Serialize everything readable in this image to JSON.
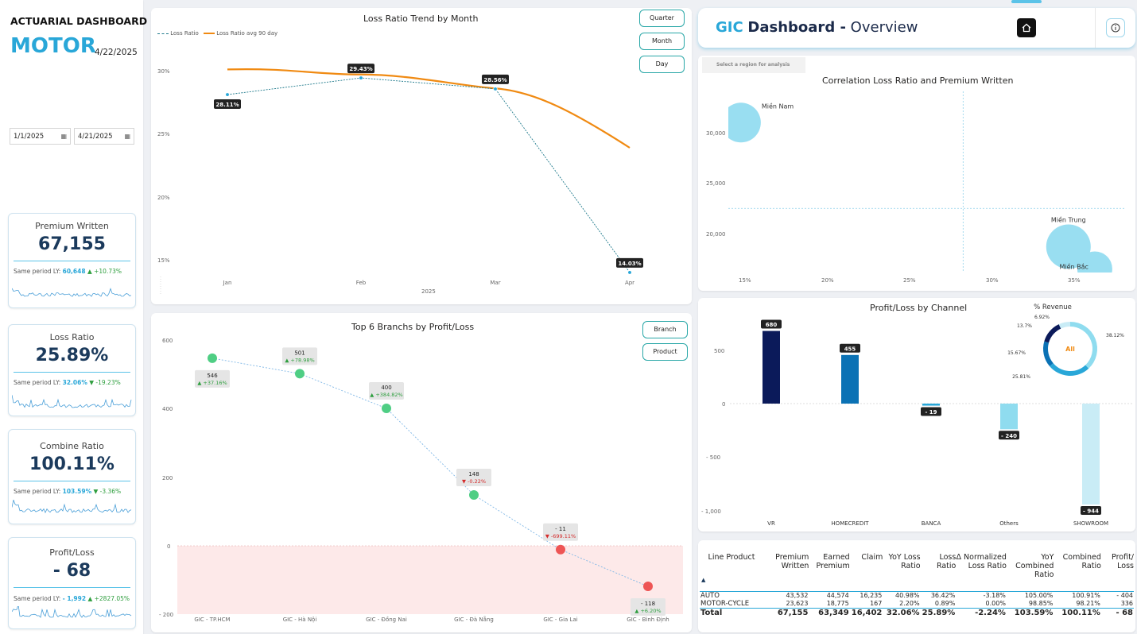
{
  "header": {
    "title": "ACTUARIAL DASHBOARD",
    "segment": "MOTOR",
    "date": "4/22/2025"
  },
  "date_range": {
    "start": "1/1/2025",
    "end": "4/21/2025"
  },
  "kpis": [
    {
      "title": "Premium Written",
      "value": "67,155",
      "ly_label": "Same period LY:",
      "ly_value": "60,648",
      "change": "▲ +10.73%",
      "dir": "up"
    },
    {
      "title": "Loss Ratio",
      "value": "25.89%",
      "ly_label": "Same period LY:",
      "ly_value": "32.06%",
      "change": "▼ -19.23%",
      "dir": "down"
    },
    {
      "title": "Combine Ratio",
      "value": "100.11%",
      "ly_label": "Same period LY:",
      "ly_value": "103.59%",
      "change": "▼ -3.36%",
      "dir": "down"
    },
    {
      "title": "Profit/Loss",
      "value": "- 68",
      "ly_label": "Same period LY:",
      "ly_value": "- 1,992",
      "change": "▲ +2827.05%",
      "dir": "up"
    }
  ],
  "loss_trend": {
    "title": "Loss Ratio Trend by Month",
    "legend": [
      "Loss Ratio",
      "Loss Ratio avg 90 day"
    ],
    "buttons": [
      "Quarter",
      "Month",
      "Day"
    ],
    "xlabel": "2025",
    "yticks": [
      "30%",
      "25%",
      "20%",
      "15%"
    ]
  },
  "branch_chart": {
    "title": "Top 6 Branchs by Profit/Loss",
    "buttons": [
      "Branch",
      "Product"
    ],
    "yticks": [
      "600",
      "400",
      "200",
      "0",
      "- 200"
    ]
  },
  "gic": {
    "brand": "GIC",
    "title": "Dashboard -",
    "subtitle": "Overview",
    "home_icon": "home-icon",
    "info_icon": "info-icon",
    "region_select": "Select a region for analysis"
  },
  "scatter": {
    "title": "Correlation Loss Ratio and Premium Written",
    "xticks": [
      "15%",
      "20%",
      "25%",
      "30%",
      "35%"
    ],
    "yticks": [
      "30,000",
      "25,000",
      "20,000"
    ]
  },
  "channel": {
    "title": "Profit/Loss by Channel",
    "yticks": [
      "500",
      "0",
      "- 500",
      "- 1,000"
    ],
    "donut_title": "% Revenue",
    "donut_center": "All"
  },
  "table": {
    "headers": [
      "Line Product",
      "Premium Written",
      "Earned Premium",
      "Claim",
      "YoY Loss Ratio",
      "Loss Ratio",
      "Δ Normalized Loss Ratio",
      "YoY Combined Ratio",
      "Combined Ratio",
      "Profit/ Loss"
    ],
    "rows": [
      [
        "AUTO",
        "43,532",
        "44,574",
        "16,235",
        "40.98%",
        "36.42%",
        "-3.18%",
        "105.00%",
        "100.91%",
        "- 404"
      ],
      [
        "MOTOR-CYCLE",
        "23,623",
        "18,775",
        "167",
        "2.20%",
        "0.89%",
        "0.00%",
        "98.85%",
        "98.21%",
        "336"
      ]
    ],
    "total": [
      "Total",
      "67,155",
      "63,349",
      "16,402",
      "32.06%",
      "25.89%",
      "-2.24%",
      "103.59%",
      "100.11%",
      "- 68"
    ]
  },
  "chart_data": [
    {
      "type": "line",
      "title": "Loss Ratio Trend by Month",
      "x": [
        "Jan",
        "Feb",
        "Mar",
        "Apr"
      ],
      "xlabel": "2025",
      "ylim": [
        14,
        31
      ],
      "series": [
        {
          "name": "Loss Ratio",
          "values": [
            28.11,
            29.43,
            28.56,
            14.03
          ],
          "labels": [
            "28.11%",
            "29.43%",
            "28.56%",
            "14.03%"
          ],
          "color": "#1f7a8c"
        },
        {
          "name": "Loss Ratio avg 90 day",
          "values": [
            30.1,
            29.7,
            28.6,
            23.9
          ],
          "color": "#f08a12"
        }
      ]
    },
    {
      "type": "line",
      "title": "Top 6 Branchs by Profit/Loss",
      "categories": [
        "GIC - TP.HCM",
        "GIC - Hà Nội",
        "GIC - Đồng Nai",
        "GIC - Đà Nẵng",
        "GIC - Gia Lai",
        "GIC - Bình Định"
      ],
      "values": [
        546,
        501,
        400,
        148,
        -11,
        -118
      ],
      "value_labels": [
        "546",
        "501",
        "400",
        "148",
        "- 11",
        "- 118"
      ],
      "changes": [
        "▲ +37.16%",
        "▲ +78.98%",
        "▲ +384.82%",
        "▼ -0.22%",
        "▼ -699.11%",
        "▲ +6.20%"
      ],
      "ylim": [
        -200,
        600
      ]
    },
    {
      "type": "scatter",
      "title": "Correlation Loss Ratio and Premium Written",
      "xlim": [
        13,
        36.5
      ],
      "ylim": [
        15600,
        32000
      ],
      "points": [
        {
          "name": "Miền Nam",
          "x": 14.8,
          "y": 31000,
          "r": 25
        },
        {
          "name": "Miền Trung",
          "x": 34.7,
          "y": 18700,
          "r": 28
        },
        {
          "name": "Miền Bắc",
          "x": 36.3,
          "y": 16500,
          "r": 22
        }
      ],
      "ref_x": 28.3,
      "ref_y": 22500
    },
    {
      "type": "bar",
      "title": "Profit/Loss by Channel",
      "categories": [
        "VR",
        "HOMECREDIT",
        "BANCA",
        "Others",
        "SHOWROOM"
      ],
      "values": [
        680,
        455,
        -19,
        -240,
        -944
      ],
      "labels": [
        "680",
        "455",
        "- 19",
        "- 240",
        "- 944"
      ],
      "colors": [
        "#0b1a5a",
        "#0b72b5",
        "#29a7d8",
        "#8fdcef",
        "#c9ecf6"
      ],
      "ylim": [
        -1050,
        760
      ]
    },
    {
      "type": "pie",
      "title": "% Revenue",
      "categories": [
        "VR",
        "HOMECREDIT",
        "BANCA",
        "Others",
        "SHOWROOM"
      ],
      "values": [
        13.7,
        15.67,
        25.81,
        38.12,
        6.92
      ],
      "labels": [
        "13.7%",
        "15.67%",
        "25.81%",
        "38.12%",
        "6.92%"
      ],
      "colors": [
        "#0b1a5a",
        "#0b72b5",
        "#29a7d8",
        "#8fdcef",
        "#c9ecf6"
      ]
    }
  ]
}
